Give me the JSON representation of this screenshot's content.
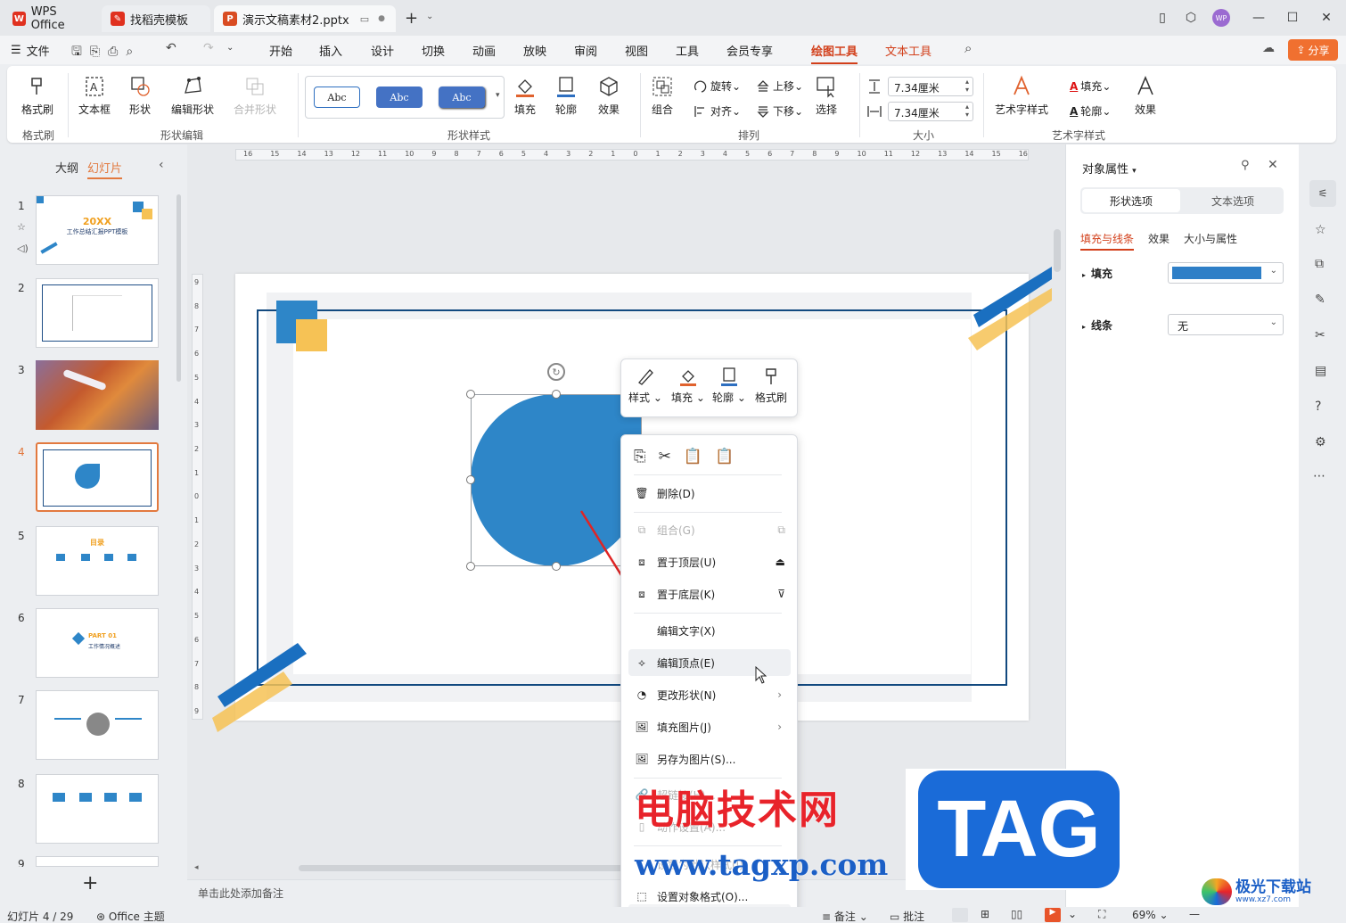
{
  "titlebar": {
    "tabs": [
      {
        "label": "WPS Office",
        "icon": "wps-logo-icon"
      },
      {
        "label": "找稻壳模板",
        "icon": "docer-icon"
      },
      {
        "label": "演示文稿素材2.pptx",
        "icon": "presentation-file-icon"
      }
    ],
    "new_tab_symbol": "+",
    "avatar_initials": "WP"
  },
  "menubar": {
    "file_label": "文件",
    "items": [
      "开始",
      "插入",
      "设计",
      "切换",
      "动画",
      "放映",
      "审阅",
      "视图",
      "工具",
      "会员专享",
      "绘图工具",
      "文本工具"
    ],
    "active_item": "绘图工具",
    "share_label": "分享"
  },
  "ribbon": {
    "format_painter": "格式刷",
    "group_format_painter": "格式刷",
    "textbox": "文本框",
    "shape": "形状",
    "edit_shape": "编辑形状",
    "merge_shape": "合并形状",
    "group_shape_edit": "形状编辑",
    "style_sample": "Abc",
    "fill": "填充",
    "outline": "轮廓",
    "effect": "效果",
    "group_shape_style": "形状样式",
    "combine": "组合",
    "rotate": "旋转",
    "align": "对齐",
    "bring_forward": "上移",
    "send_backward": "下移",
    "select": "选择",
    "group_arrange": "排列",
    "height_value": "7.34厘米",
    "width_value": "7.34厘米",
    "group_size": "大小",
    "wordart_style": "艺术字样式",
    "text_fill": "填充",
    "text_outline": "轮廓",
    "text_effect": "效果",
    "group_wordart": "艺术字样式"
  },
  "leftpane": {
    "tab_outline": "大纲",
    "tab_slides": "幻灯片",
    "slide_numbers": [
      "1",
      "2",
      "3",
      "4",
      "5",
      "6",
      "7",
      "8",
      "9"
    ],
    "selected_slide": "4",
    "thumb1_title": "20XX",
    "thumb1_subtitle": "工作总结汇报PPT模板",
    "thumb5_title": "目录",
    "thumb6_title": "PART 01",
    "thumb6_subtitle": "工作情况概述",
    "add_symbol": "+"
  },
  "ruler": {
    "h_ticks": [
      "16",
      "15",
      "14",
      "13",
      "12",
      "11",
      "10",
      "9",
      "8",
      "7",
      "6",
      "5",
      "4",
      "3",
      "2",
      "1",
      "0",
      "1",
      "2",
      "3",
      "4",
      "5",
      "6",
      "7",
      "8",
      "9",
      "10",
      "11",
      "12",
      "13",
      "14",
      "15",
      "16"
    ],
    "v_ticks": [
      "9",
      "8",
      "7",
      "6",
      "5",
      "4",
      "3",
      "2",
      "1",
      "0",
      "1",
      "2",
      "3",
      "4",
      "5",
      "6",
      "7",
      "8",
      "9"
    ]
  },
  "mini_toolbar": {
    "style": "样式",
    "fill": "填充",
    "outline": "轮廓",
    "format_painter": "格式刷"
  },
  "context_menu": {
    "delete": "删除(D)",
    "group": "组合(G)",
    "bring_to_front": "置于顶层(U)",
    "send_to_back": "置于底层(K)",
    "edit_text": "编辑文字(X)",
    "edit_points": "编辑顶点(E)",
    "change_shape": "更改形状(N)",
    "fill_picture": "填充图片(J)",
    "save_as_picture": "另存为图片(S)...",
    "hyperlink": "超链接(H)...",
    "action_settings": "动作设置(A)...",
    "set_default": "设置为默认样式(I)",
    "format_object": "设置对象格式(O)..."
  },
  "notes": {
    "placeholder": "单击此处添加备注"
  },
  "rightpane": {
    "title": "对象属性",
    "tab_shape": "形状选项",
    "tab_text": "文本选项",
    "sub_fill_line": "填充与线条",
    "sub_effect": "效果",
    "sub_size": "大小与属性",
    "fill_label": "填充",
    "line_label": "线条",
    "line_value": "无",
    "fill_color": "#2e7fc7"
  },
  "status": {
    "slide_info": "幻灯片 4 / 29",
    "theme": "Office 主题",
    "notes_btn": "备注",
    "comments_btn": "批注",
    "zoom": "69%"
  },
  "watermark": {
    "site_name": "电脑技术网",
    "site_url": "www.tagxp.com",
    "tag": "TAG",
    "corner": "极光下载站",
    "corner_url": "www.xz7.com"
  },
  "colors": {
    "accent": "#d23f1a",
    "shape_blue": "#2e86c8",
    "frame_blue": "#12497f",
    "deco_yellow": "#f6c255"
  }
}
